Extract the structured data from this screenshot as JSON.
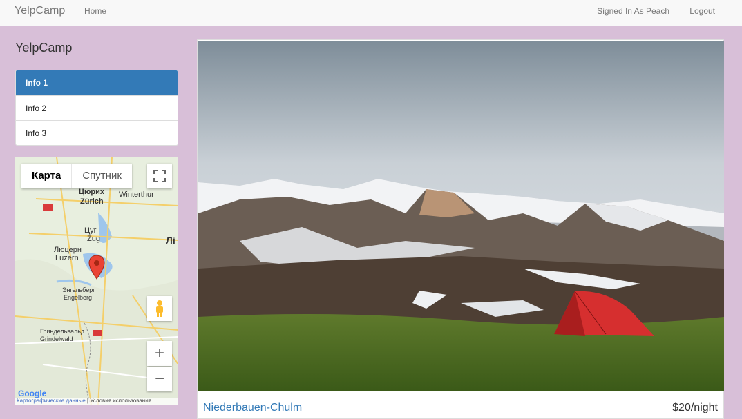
{
  "navbar": {
    "brand": "YelpCamp",
    "home": "Home",
    "user": "Signed In As Peach",
    "logout": "Logout"
  },
  "sidebar": {
    "title": "YelpCamp",
    "items": [
      {
        "label": "Info 1",
        "active": true
      },
      {
        "label": "Info 2",
        "active": false
      },
      {
        "label": "Info 3",
        "active": false
      }
    ]
  },
  "map": {
    "type_map": "Карта",
    "type_satellite": "Спутник",
    "places": [
      "Цюрих",
      "Zürich",
      "Winterthur",
      "Цуг",
      "Zug",
      "Люцерн",
      "Luzern",
      "Энгельберг",
      "Engelberg",
      "Гриндельвальд",
      "Grindelwald",
      "Лі"
    ],
    "footer_data": "Картографические данные",
    "footer_terms": "Условия использования",
    "brand": "Google"
  },
  "campground": {
    "name": "Niederbauen-Chulm",
    "price": "$20/night"
  },
  "colors": {
    "page_bg": "#d8bfd8",
    "primary": "#337ab7"
  }
}
